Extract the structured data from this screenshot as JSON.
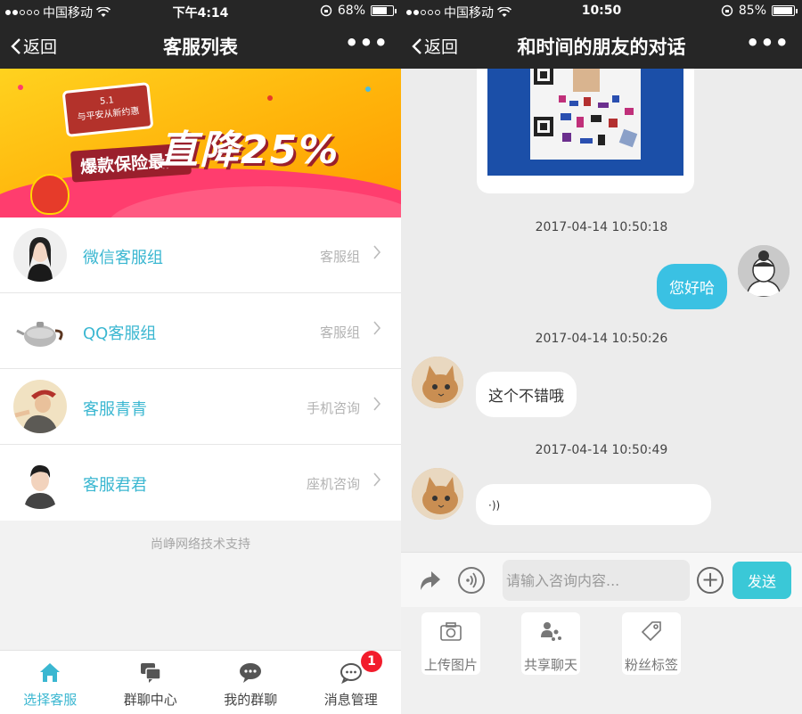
{
  "left": {
    "status": {
      "carrier": "中国移动",
      "time": "下午4:14",
      "battery": "68%",
      "battery_level": 0.68
    },
    "nav": {
      "back_label": "返回",
      "title": "客服列表",
      "more": "•••"
    },
    "banner": {
      "sign_line1": "5.1",
      "sign_line2": "与平安从新约惠",
      "headline": "爆款保险最高",
      "drop": "直降25%"
    },
    "items": [
      {
        "name": "微信客服组",
        "tag": "客服组"
      },
      {
        "name": "QQ客服组",
        "tag": "客服组"
      },
      {
        "name": "客服青青",
        "tag": "手机咨询"
      },
      {
        "name": "客服君君",
        "tag": "座机咨询"
      }
    ],
    "footer_note": "尚峥网络技术支持",
    "tabs": [
      {
        "label": "选择客服",
        "icon": "home-icon"
      },
      {
        "label": "群聊中心",
        "icon": "group-chat-icon"
      },
      {
        "label": "我的群聊",
        "icon": "my-chat-icon"
      },
      {
        "label": "消息管理",
        "icon": "message-icon",
        "badge": "1"
      }
    ]
  },
  "right": {
    "status": {
      "carrier": "中国移动",
      "time": "10:50",
      "battery": "85%",
      "battery_level": 0.85
    },
    "nav": {
      "back_label": "返回",
      "title": "和时间的朋友的对话",
      "more": "•••"
    },
    "messages": [
      {
        "timestamp": "2017-04-14 10:50:18",
        "from": "me",
        "text": "您好哈"
      },
      {
        "timestamp": "2017-04-14 10:50:26",
        "from": "other",
        "text": "这个不错哦"
      },
      {
        "timestamp": "2017-04-14 10:50:49",
        "from": "other",
        "text": "·))"
      }
    ],
    "input": {
      "placeholder": "请输入咨询内容...",
      "send_label": "发送"
    },
    "tools": [
      {
        "label": "上传图片",
        "icon": "camera-icon"
      },
      {
        "label": "共享聊天",
        "icon": "share-users-icon"
      },
      {
        "label": "粉丝标签",
        "icon": "tag-icon"
      }
    ]
  },
  "colors": {
    "accent": "#3bb7d1",
    "bubble": "#3ac1e3",
    "send": "#3ac8d7",
    "badge": "#f21c2c"
  }
}
